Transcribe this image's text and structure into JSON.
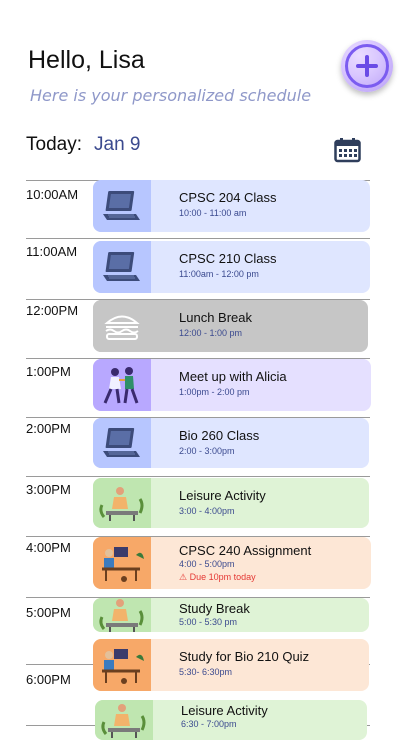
{
  "header": {
    "greeting": "Hello, Lisa",
    "subtitle": "Here is your personalized schedule"
  },
  "today": {
    "label": "Today:",
    "date": "Jan 9"
  },
  "add_button": {
    "icon": "plus-icon"
  },
  "calendar": {
    "icon": "calendar-icon"
  },
  "times": [
    "10:00AM",
    "11:00AM",
    "12:00PM",
    "1:00PM",
    "2:00PM",
    "3:00PM",
    "4:00PM",
    "5:00PM",
    "6:00PM"
  ],
  "events": [
    {
      "title": "CPSC 204 Class",
      "time": "10:00 - 11:00 am",
      "bg": "#dfe6ff",
      "thumb_bg": "#b7c6ff",
      "icon": "laptop-icon"
    },
    {
      "title": "CPSC 210 Class",
      "time": "11:00am - 12:00 pm",
      "bg": "#dfe6ff",
      "thumb_bg": "#b7c6ff",
      "icon": "laptop-icon"
    },
    {
      "title": "Lunch Break",
      "time": "12:00 - 1:00 pm",
      "bg": "#c6c6c6",
      "thumb_bg": "#c6c6c6",
      "icon": "burger-icon"
    },
    {
      "title": "Meet up with Alicia",
      "time": "1:00pm - 2:00 pm",
      "bg": "#e5e0ff",
      "thumb_bg": "#b8a8ff",
      "icon": "friends-icon"
    },
    {
      "title": "Bio 260 Class",
      "time": "2:00 - 3:00pm",
      "bg": "#dfe6ff",
      "thumb_bg": "#b7c6ff",
      "icon": "laptop-icon"
    },
    {
      "title": "Leisure Activity",
      "time": "3:00 - 4:00pm",
      "bg": "#dff3d6",
      "thumb_bg": "#bfe6b0",
      "icon": "relaxing-person-icon"
    },
    {
      "title": "CPSC 240 Assignment",
      "time": "4:00 - 5:00pm",
      "warning": "Due 10pm today",
      "bg": "#fde7d6",
      "thumb_bg": "#f7a868",
      "icon": "desk-work-icon"
    },
    {
      "title": "Study Break",
      "time": "5:00 - 5:30 pm",
      "bg": "#dff3d6",
      "thumb_bg": "#bfe6b0",
      "icon": "relaxing-person-icon"
    },
    {
      "title": "Study for Bio 210 Quiz",
      "time": "5:30- 6:30pm",
      "bg": "#fde7d6",
      "thumb_bg": "#f7a868",
      "icon": "desk-work-icon"
    },
    {
      "title": "Leisure Activity",
      "time": "6:30 - 7:00pm",
      "bg": "#dff3d6",
      "thumb_bg": "#bfe6b0",
      "icon": "relaxing-person-icon"
    }
  ]
}
